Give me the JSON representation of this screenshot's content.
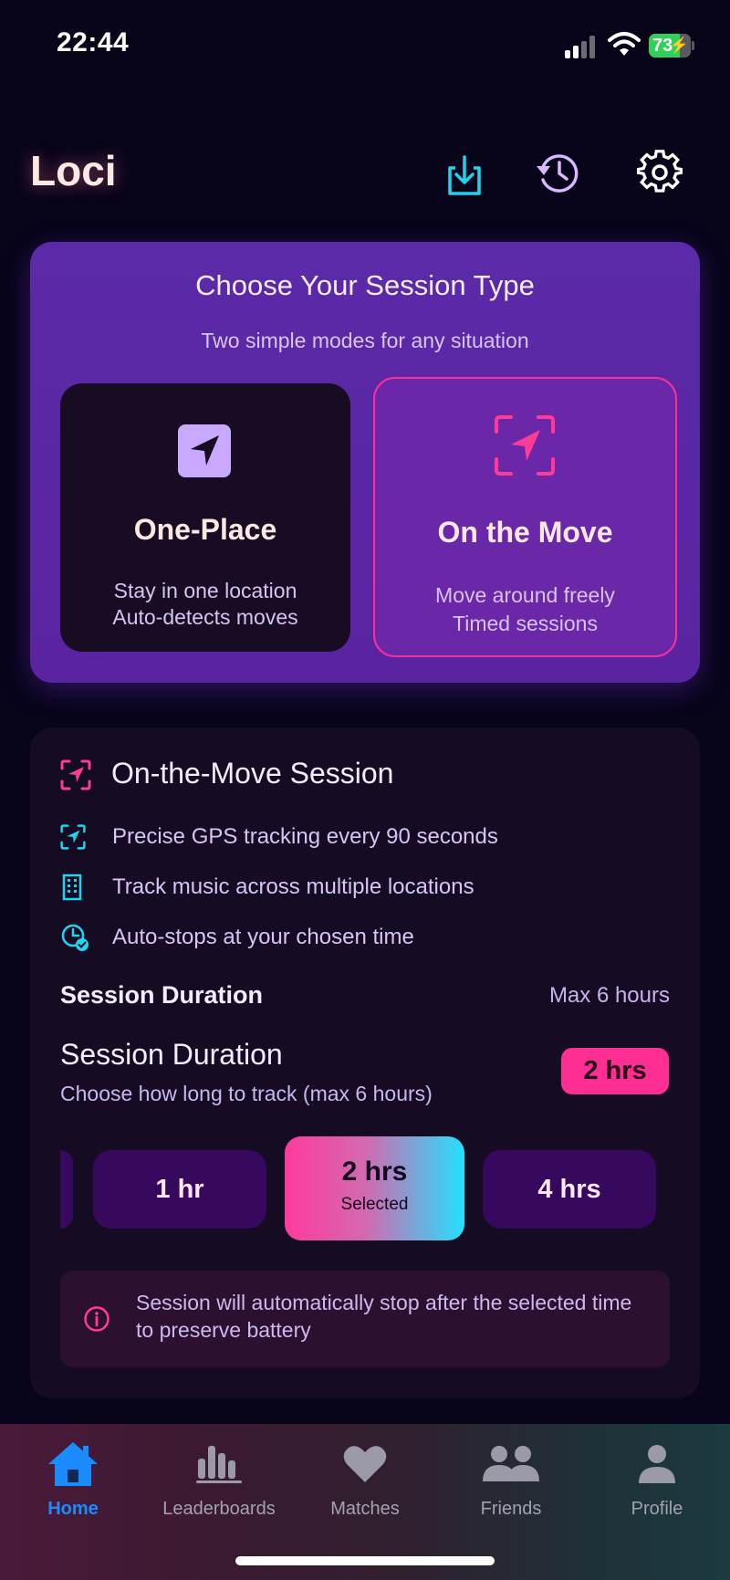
{
  "status_bar": {
    "time": "22:44",
    "battery": "73"
  },
  "header": {
    "title": "Loci"
  },
  "session_type": {
    "title": "Choose Your Session Type",
    "subtitle": "Two simple modes for any situation",
    "options": [
      {
        "name": "One-Place",
        "line1": "Stay in one location",
        "line2": "Auto-detects moves",
        "selected": false
      },
      {
        "name": "On the Move",
        "line1": "Move around freely",
        "line2": "Timed sessions",
        "selected": true
      }
    ]
  },
  "session_detail": {
    "title": "On-the-Move Session",
    "features": [
      {
        "icon": "gps-target-icon",
        "text": "Precise GPS tracking every 90 seconds"
      },
      {
        "icon": "building-icon",
        "text": "Track music across multiple locations"
      },
      {
        "icon": "clock-check-icon",
        "text": "Auto-stops at your chosen time"
      }
    ],
    "duration_label": "Session Duration",
    "duration_max": "Max 6 hours",
    "duration_heading": "Session Duration",
    "duration_help": "Choose how long to track (max 6 hours)",
    "duration_badge": "2 hrs",
    "duration_options": {
      "prev": "1 hr",
      "selected": "2 hrs",
      "selected_caption": "Selected",
      "next": "4 hrs"
    },
    "info": "Session will automatically stop after the selected time to preserve battery"
  },
  "tabs": [
    {
      "label": "Home",
      "icon": "home-icon",
      "active": true
    },
    {
      "label": "Leaderboards",
      "icon": "leaderboard-icon",
      "active": false
    },
    {
      "label": "Matches",
      "icon": "heart-icon",
      "active": false
    },
    {
      "label": "Friends",
      "icon": "friends-icon",
      "active": false
    },
    {
      "label": "Profile",
      "icon": "profile-icon",
      "active": false
    }
  ],
  "colors": {
    "accent_pink": "#ff2e93",
    "accent_cyan": "#22d3ee",
    "active_tab": "#1a8cff",
    "card_purple": "#5b2aa8"
  }
}
